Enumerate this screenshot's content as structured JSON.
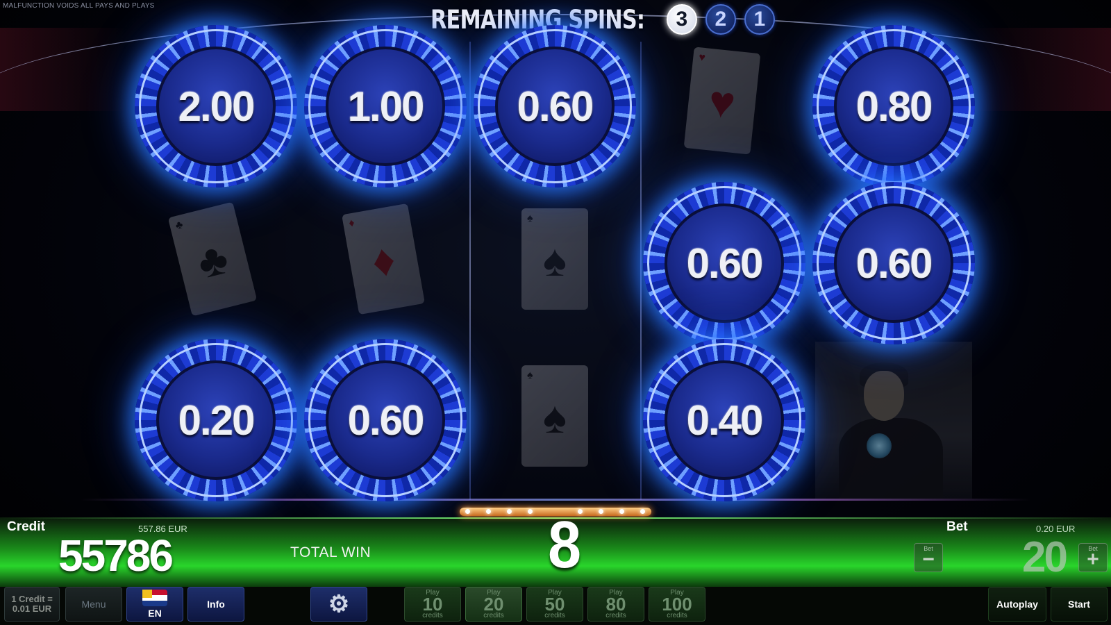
{
  "header": {
    "disclaimer": "MALFUNCTION VOIDS ALL PAYS AND PLAYS",
    "remaining_spins_label": "REMAINING SPINS:",
    "spin_counters": [
      "3",
      "2",
      "1"
    ],
    "active_spin": "3"
  },
  "grid": {
    "coins": [
      {
        "value": "2.00"
      },
      {
        "value": "1.00"
      },
      {
        "value": "0.60"
      },
      {
        "value": "0.80"
      },
      {
        "value": "0.60"
      },
      {
        "value": "0.60"
      },
      {
        "value": "0.20"
      },
      {
        "value": "0.60"
      },
      {
        "value": "0.40"
      }
    ],
    "cards": [
      {
        "suit": "♥",
        "color": "#b01020"
      },
      {
        "suit": "♣",
        "color": "#202020"
      },
      {
        "suit": "♦",
        "color": "#c01818"
      },
      {
        "suit": "♠",
        "color": "#202020"
      },
      {
        "suit": "♠",
        "color": "#202020"
      }
    ]
  },
  "panel": {
    "credit_label": "Credit",
    "credit_eur": "557.86 EUR",
    "credit_value": "55786",
    "total_win_label": "TOTAL WIN",
    "total_win_value": "8",
    "bet_label": "Bet",
    "bet_eur": "0.20 EUR",
    "bet_value": "20",
    "bet_minus": {
      "small": "Bet",
      "symbol": "−"
    },
    "bet_plus": {
      "small": "Bet",
      "symbol": "+"
    }
  },
  "toolbar": {
    "rate_line1": "1 Credit =",
    "rate_line2": "0.01 EUR",
    "menu": "Menu",
    "language": "EN",
    "info": "Info",
    "settings_icon": "gear-icon",
    "play_options": [
      {
        "top": "Play",
        "value": "10",
        "bottom": "credits"
      },
      {
        "top": "Play",
        "value": "20",
        "bottom": "credits"
      },
      {
        "top": "Play",
        "value": "50",
        "bottom": "credits"
      },
      {
        "top": "Play",
        "value": "80",
        "bottom": "credits"
      },
      {
        "top": "Play",
        "value": "100",
        "bottom": "credits"
      }
    ],
    "autoplay": "Autoplay",
    "start": "Start"
  },
  "colors": {
    "coin_blue": "#1d3bd4",
    "panel_green": "#29d62b",
    "marquee_orange": "#ff9a3a"
  }
}
